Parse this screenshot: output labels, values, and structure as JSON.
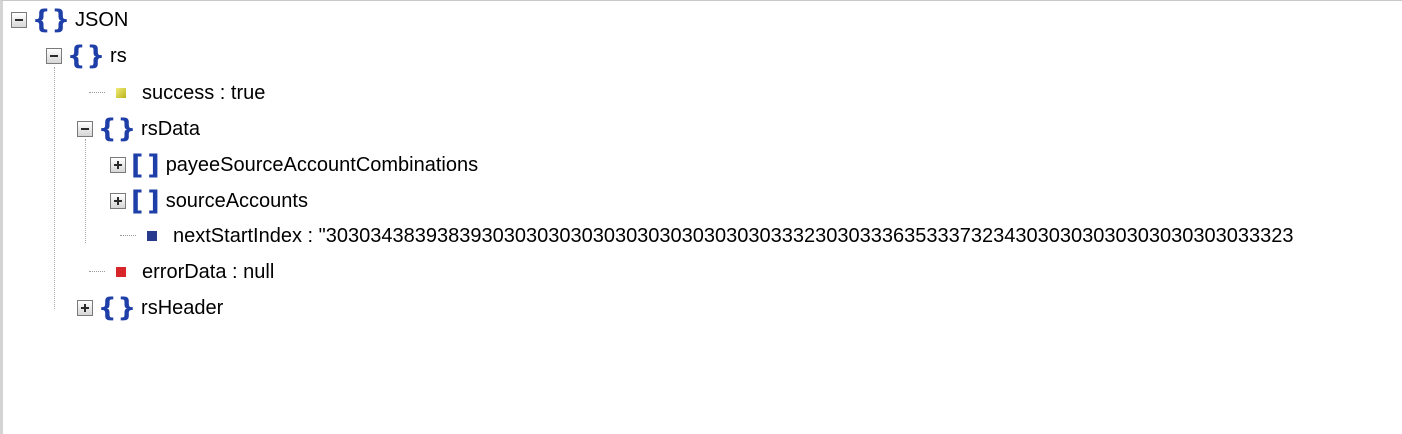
{
  "tree": {
    "root": {
      "key": "JSON"
    },
    "rs": {
      "key": "rs"
    },
    "success": {
      "key": "success",
      "separator": " : ",
      "value": "true"
    },
    "rsData": {
      "key": "rsData"
    },
    "payee": {
      "key": "payeeSourceAccountCombinations"
    },
    "sourceAccounts": {
      "key": "sourceAccounts"
    },
    "nextStartIndex": {
      "key": "nextStartIndex",
      "separator": " : ",
      "value": "\"303034383938393030303030303030303030303033323030333635333732343030303030303030303033323"
    },
    "errorData": {
      "key": "errorData",
      "separator": " : ",
      "value": "null"
    },
    "rsHeader": {
      "key": "rsHeader"
    }
  },
  "colors": {
    "object_brace": "#1f3fa8",
    "bool_marker": "#c8c020",
    "string_marker": "#273a8c",
    "null_marker": "#d8252a"
  },
  "icons": {
    "expanded": "minus-box-icon",
    "collapsed": "plus-box-icon",
    "object": "curly-braces-icon",
    "array": "square-brackets-icon"
  }
}
